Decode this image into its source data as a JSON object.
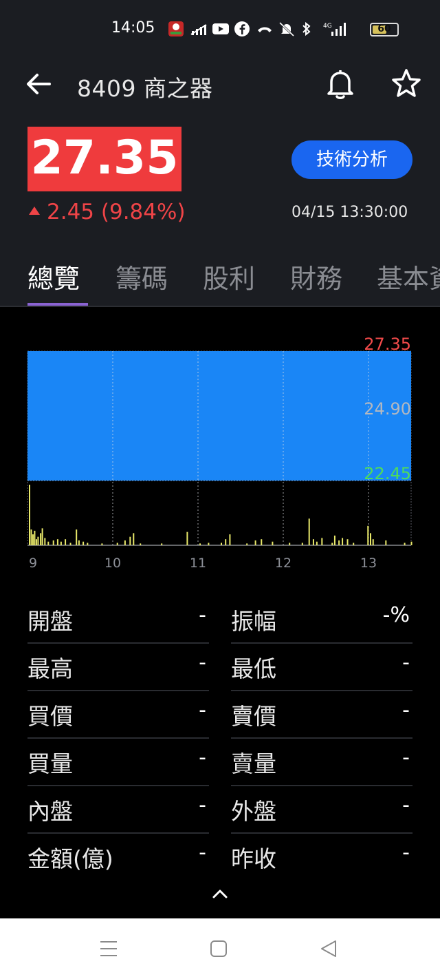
{
  "status_bar": {
    "time": "14:05",
    "network": "4G",
    "battery": "60",
    "battery_level": 0.6
  },
  "header": {
    "title": "8409 商之器",
    "price": "27.35",
    "change": "2.45 (9.84%)",
    "timestamp": "04/15 13:30:00",
    "tech_button": "技術分析",
    "colors": {
      "up": "#ef3b3d",
      "accent": "#1a66f0",
      "tab_indicator": "#8a63d2"
    }
  },
  "tabs": [
    {
      "label": "總覽",
      "active": true
    },
    {
      "label": "籌碼",
      "active": false
    },
    {
      "label": "股利",
      "active": false
    },
    {
      "label": "財務",
      "active": false
    },
    {
      "label": "基本資料",
      "active": false
    }
  ],
  "chart_data": {
    "type": "area",
    "ylim": [
      22.45,
      27.35
    ],
    "y_labels": [
      "27.35",
      "24.90",
      "22.45"
    ],
    "x_ticks": [
      "9",
      "10",
      "11",
      "12",
      "13"
    ],
    "xlim": [
      9.0,
      13.5
    ],
    "price_line": {
      "x": [
        9.0,
        13.5
      ],
      "y": [
        27.35,
        27.35
      ]
    },
    "volume_bars": [
      {
        "x": 9.0,
        "v": 100
      },
      {
        "x": 9.02,
        "v": 26
      },
      {
        "x": 9.04,
        "v": 18
      },
      {
        "x": 9.06,
        "v": 24
      },
      {
        "x": 9.08,
        "v": 10
      },
      {
        "x": 9.1,
        "v": 14
      },
      {
        "x": 9.13,
        "v": 20
      },
      {
        "x": 9.15,
        "v": 28
      },
      {
        "x": 9.18,
        "v": 12
      },
      {
        "x": 9.22,
        "v": 6
      },
      {
        "x": 9.28,
        "v": 8
      },
      {
        "x": 9.33,
        "v": 10
      },
      {
        "x": 9.37,
        "v": 6
      },
      {
        "x": 9.42,
        "v": 10
      },
      {
        "x": 9.48,
        "v": 4
      },
      {
        "x": 9.55,
        "v": 26
      },
      {
        "x": 9.58,
        "v": 8
      },
      {
        "x": 9.63,
        "v": 6
      },
      {
        "x": 9.68,
        "v": 4
      },
      {
        "x": 9.85,
        "v": 3
      },
      {
        "x": 10.03,
        "v": 4
      },
      {
        "x": 10.12,
        "v": 8
      },
      {
        "x": 10.18,
        "v": 14
      },
      {
        "x": 10.22,
        "v": 20
      },
      {
        "x": 10.3,
        "v": 3
      },
      {
        "x": 10.55,
        "v": 3
      },
      {
        "x": 10.85,
        "v": 22
      },
      {
        "x": 11.0,
        "v": 3
      },
      {
        "x": 11.1,
        "v": 4
      },
      {
        "x": 11.25,
        "v": 4
      },
      {
        "x": 11.3,
        "v": 10
      },
      {
        "x": 11.35,
        "v": 18
      },
      {
        "x": 11.55,
        "v": 3
      },
      {
        "x": 11.65,
        "v": 8
      },
      {
        "x": 11.72,
        "v": 10
      },
      {
        "x": 11.85,
        "v": 6
      },
      {
        "x": 12.05,
        "v": 4
      },
      {
        "x": 12.2,
        "v": 4
      },
      {
        "x": 12.28,
        "v": 44
      },
      {
        "x": 12.33,
        "v": 10
      },
      {
        "x": 12.37,
        "v": 6
      },
      {
        "x": 12.43,
        "v": 12
      },
      {
        "x": 12.55,
        "v": 4
      },
      {
        "x": 12.58,
        "v": 16
      },
      {
        "x": 12.63,
        "v": 8
      },
      {
        "x": 12.67,
        "v": 12
      },
      {
        "x": 12.73,
        "v": 10
      },
      {
        "x": 12.8,
        "v": 4
      },
      {
        "x": 12.97,
        "v": 32
      },
      {
        "x": 13.0,
        "v": 20
      },
      {
        "x": 13.03,
        "v": 10
      },
      {
        "x": 13.18,
        "v": 8
      },
      {
        "x": 13.4,
        "v": 4
      },
      {
        "x": 13.48,
        "v": 6
      }
    ],
    "colors": {
      "area": "#1a86f6",
      "up_label": "#f24a4a",
      "mid_label": "#b4b8c0",
      "down_label": "#4fdc5a",
      "volume": "#e9e96a",
      "axis_text": "#8d9098"
    }
  },
  "stats": {
    "left": [
      {
        "label": "開盤",
        "value": "-"
      },
      {
        "label": "最高",
        "value": "-"
      },
      {
        "label": "買價",
        "value": "-"
      },
      {
        "label": "買量",
        "value": "-"
      },
      {
        "label": "內盤",
        "value": "-"
      },
      {
        "label": "金額(億)",
        "value": "-"
      }
    ],
    "right": [
      {
        "label": "振幅",
        "value": "-%"
      },
      {
        "label": "最低",
        "value": "-"
      },
      {
        "label": "賣價",
        "value": "-"
      },
      {
        "label": "賣量",
        "value": "-"
      },
      {
        "label": "外盤",
        "value": "-"
      },
      {
        "label": "昨收",
        "value": "-"
      }
    ]
  },
  "icons": {
    "back": "arrow-left-icon",
    "bell": "bell-icon",
    "star": "star-icon",
    "collapse": "chevron-up-icon",
    "nav_menu": "menu-icon",
    "nav_home": "home-icon",
    "nav_back": "back-triangle-icon"
  }
}
